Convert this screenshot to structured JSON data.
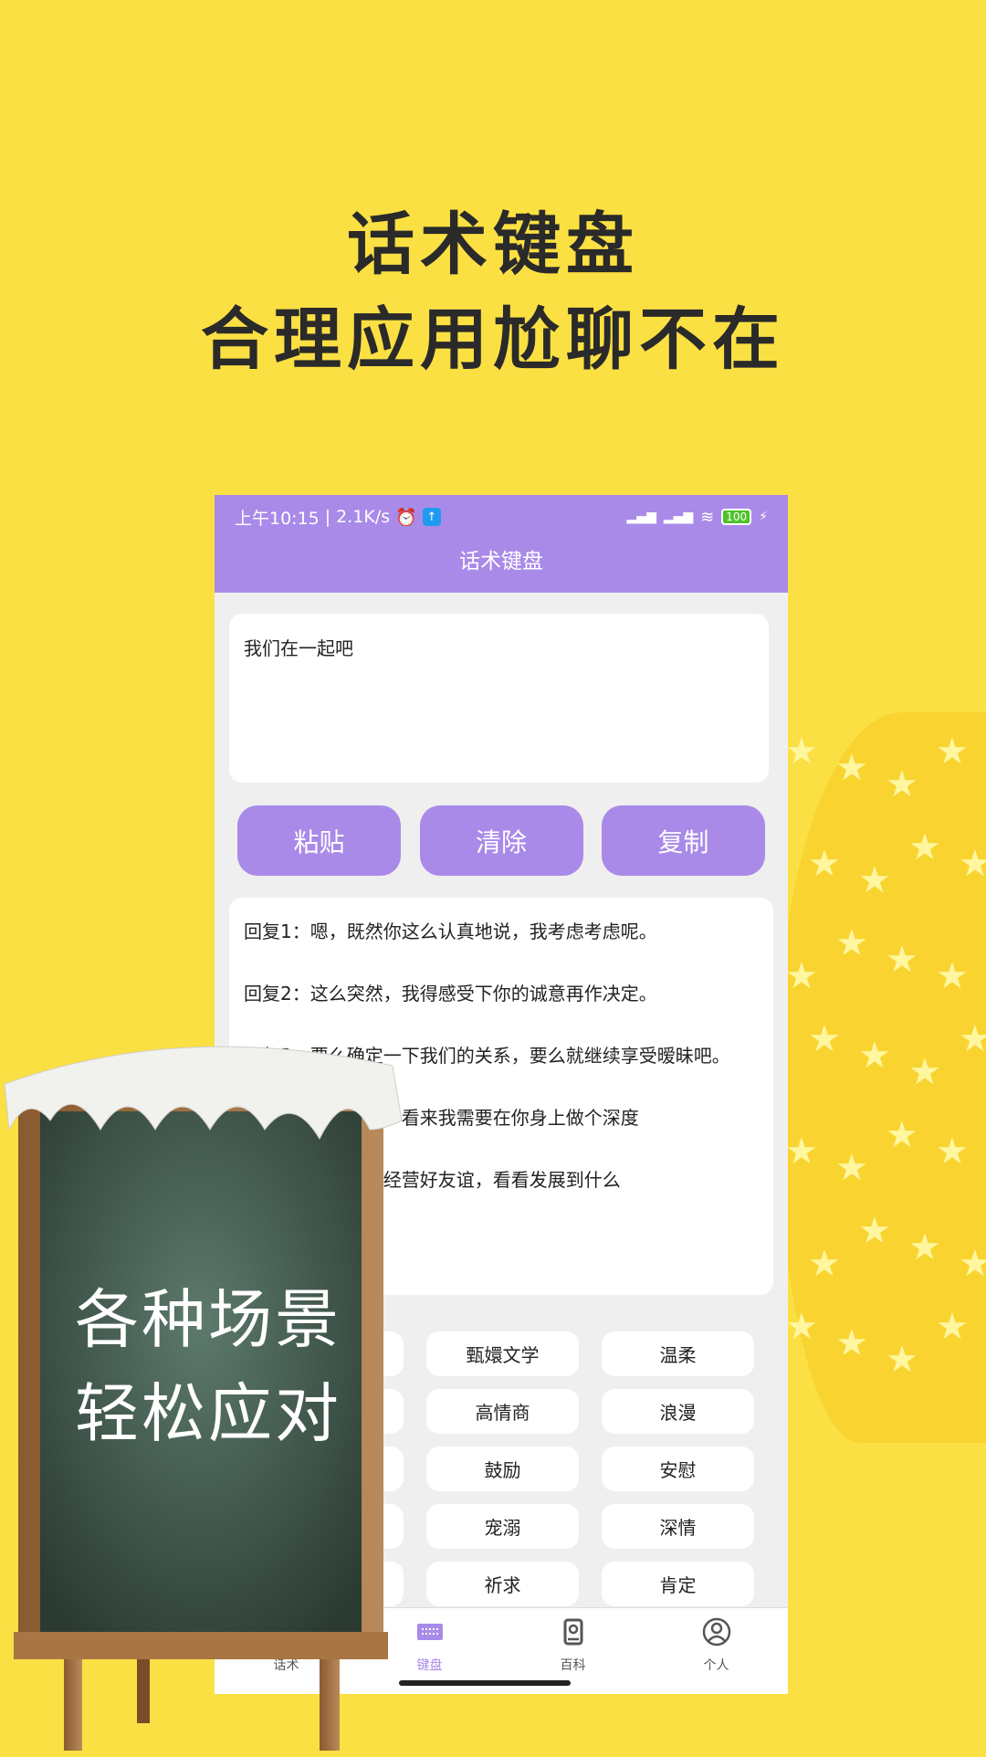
{
  "promo": {
    "headline1": "话术键盘",
    "headline2": "合理应用尬聊不在",
    "board_line1": "各种场景",
    "board_line2": "轻松应对"
  },
  "colors": {
    "accent": "#A98AE8",
    "background": "#FBE043"
  },
  "status_bar": {
    "time": "上午10:15",
    "speed": "2.1K/s",
    "battery": "100",
    "icons": [
      "alarm-icon",
      "upload-icon",
      "signal-icon",
      "signal-icon",
      "wifi-icon",
      "battery-icon",
      "charging-icon"
    ]
  },
  "app": {
    "title": "话术键盘"
  },
  "input": {
    "value": "我们在一起吧"
  },
  "buttons": {
    "paste": "粘贴",
    "clear": "清除",
    "copy": "复制"
  },
  "replies": [
    "回复1：嗯，既然你这么认真地说，我考虑考虑呢。",
    "回复2：这么突然，我得感受下你的诚意再作决定。",
    "回复3：要么确定一下我们的关系，要么就继续享受暧昧吧。",
    "回复4：这么勇敢，看来我需要在你身上做个深度",
    "回复5：能不能先经营好友谊，看看发展到什么"
  ],
  "categories": [
    [
      "",
      "甄嬛文学",
      "温柔"
    ],
    [
      "",
      "高情商",
      "浪漫"
    ],
    [
      "",
      "鼓励",
      "安慰"
    ],
    [
      "",
      "宠溺",
      "深情"
    ],
    [
      "",
      "祈求",
      "肯定"
    ]
  ],
  "nav": [
    {
      "label": "话术",
      "icon": "scripts-icon",
      "active": false
    },
    {
      "label": "键盘",
      "icon": "keyboard-icon",
      "active": true
    },
    {
      "label": "百科",
      "icon": "encyclopedia-icon",
      "active": false
    },
    {
      "label": "个人",
      "icon": "profile-icon",
      "active": false
    }
  ]
}
